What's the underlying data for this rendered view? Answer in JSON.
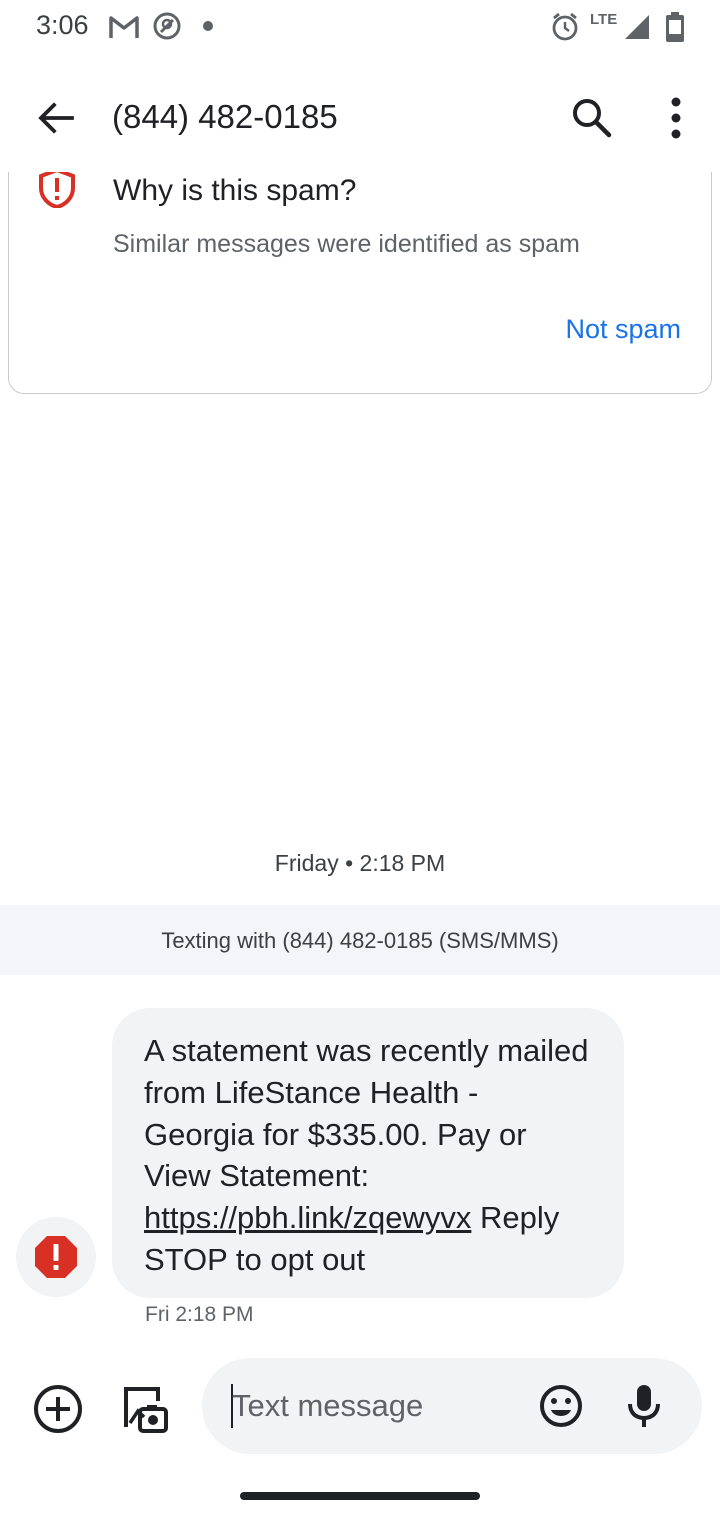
{
  "status_bar": {
    "time": "3:06",
    "icons": [
      "gmail-icon",
      "at-sign-icon",
      "dot-icon",
      "alarm-icon",
      "lte-icon",
      "signal-icon",
      "battery-icon"
    ],
    "network_label": "LTE"
  },
  "app_bar": {
    "title": "(844) 482-0185",
    "icons": [
      "back-arrow-icon",
      "search-icon",
      "more-vert-icon"
    ]
  },
  "spam_card": {
    "heading": "Why is this spam?",
    "description": "Similar messages were identified as spam",
    "action_label": "Not spam",
    "accent_color": "#1a73e8",
    "warning_color": "#d93025"
  },
  "conversation": {
    "date_separator": "Friday • 2:18 PM",
    "sms_banner": "Texting with (844) 482-0185 (SMS/MMS)",
    "messages": [
      {
        "text_before_link": "A statement was recently mailed from LifeStance Health - Georgia for $335.00. Pay or View Statement: ",
        "link": "https://pbh.link/zqewyvx",
        "text_after_link": " Reply STOP to opt out",
        "timestamp": "Fri 2:18 PM",
        "status_icon": "error-alert-icon"
      }
    ]
  },
  "compose": {
    "placeholder": "Text message",
    "value": "",
    "icons": [
      "add-circle-icon",
      "gallery-camera-icon",
      "emoji-icon",
      "mic-icon"
    ]
  }
}
